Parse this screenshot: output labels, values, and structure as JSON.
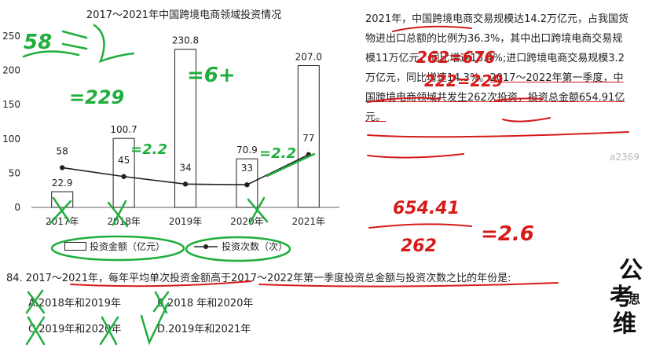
{
  "chart_data": {
    "type": "bar",
    "title": "2017～2021年中国跨境电商领域投资情况",
    "categories": [
      "2017年",
      "2018年",
      "2019年",
      "2020年",
      "2021年"
    ],
    "ylim": [
      0,
      250
    ],
    "yticks": [
      0,
      50,
      100,
      150,
      200,
      250
    ],
    "ytick_labels": [
      "0",
      "50",
      "100",
      "150",
      "200",
      "250"
    ],
    "grid": false,
    "legend_position": "bottom",
    "series": [
      {
        "name": "投资金额（亿元）",
        "type": "bar",
        "values": [
          22.9,
          100.7,
          230.8,
          70.9,
          207.0
        ],
        "labels": [
          "22.9",
          "100.7",
          "230.8",
          "70.9",
          "207.0"
        ]
      },
      {
        "name": "投资次数（次）",
        "type": "line",
        "values": [
          58,
          45,
          34,
          33,
          77
        ],
        "labels": [
          "58",
          "45",
          "34",
          "33",
          "77"
        ]
      }
    ]
  },
  "paragraph": {
    "part1": "2021年，中国跨境电商交易规模达14.2万亿元，占我国货物进出口总额的比例为36.3%，其中出口跨境电商交易规模11万亿元，同比增速13.4%;进口跨境电商交易规模3.2万亿元，同比增速14.3%。",
    "part2": "2017～2022年第一季度，中国跨境电商领域共发生262次投资，投资总金额654.91亿元。"
  },
  "question": {
    "stem": "84. 2017～2021年，每年平均单次投资金额高于2017～2022年第一季度投资总金额与投资次数之比的年份是:",
    "option_a": "A.2018年和2019年",
    "option_b": "B.2018 年和2020年",
    "option_c": "C.2019年和2020年",
    "option_d": "D.2019年和2021年"
  },
  "watermark": "a2369",
  "logo_text": "公考思维",
  "handwriting": {
    "note_1": "58",
    "note_2": "=229",
    "note_3": "=6+",
    "note_4": "=2.2",
    "note_5": "=2.2",
    "note_6": "262=676",
    "note_7": "222=229",
    "note_8": "654.41",
    "note_9": "262",
    "note_10": "=2.6"
  },
  "colors": {
    "ink_red": "#d61a1a",
    "ink_green": "#1fae3c",
    "ink_green_light": "#7fd98f"
  }
}
